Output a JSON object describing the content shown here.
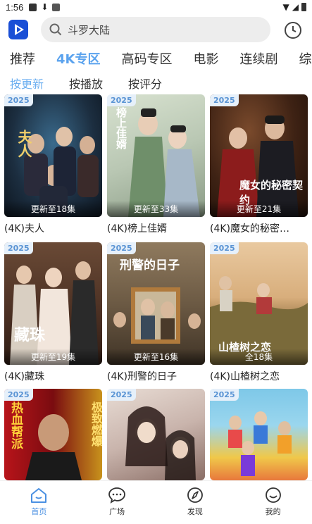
{
  "status_bar": {
    "time": "1:56"
  },
  "search": {
    "placeholder": "斗罗大陆"
  },
  "category_tabs": [
    {
      "label": "推荐"
    },
    {
      "label": "4K专区"
    },
    {
      "label": "高码专区"
    },
    {
      "label": "电影"
    },
    {
      "label": "连续剧"
    },
    {
      "label": "综"
    }
  ],
  "active_category": "4K专区",
  "sort_tabs": [
    {
      "label": "按更新"
    },
    {
      "label": "按播放"
    },
    {
      "label": "按评分"
    }
  ],
  "active_sort": "按更新",
  "cards": [
    {
      "year": "2025",
      "status": "更新至18集",
      "title": "(4K)夫人",
      "poster_text": "夫人"
    },
    {
      "year": "2025",
      "status": "更新至33集",
      "title": "(4K)榜上佳婿",
      "poster_text": "榜上佳婿"
    },
    {
      "year": "2025",
      "status": "更新至21集",
      "title": "(4K)魔女的秘密…",
      "poster_text": "魔女的秘密契约"
    },
    {
      "year": "2025",
      "status": "更新至19集",
      "title": "(4K)藏珠",
      "poster_text": "藏珠"
    },
    {
      "year": "2025",
      "status": "更新至16集",
      "title": "(4K)刑警的日子",
      "poster_text": "刑警的日子"
    },
    {
      "year": "2025",
      "status": "全18集",
      "title": "(4K)山楂树之恋",
      "poster_text": "山楂树之恋"
    },
    {
      "year": "2025",
      "status": "",
      "title": "",
      "poster_text": "热血帮派"
    },
    {
      "year": "2025",
      "status": "",
      "title": "",
      "poster_text": ""
    },
    {
      "year": "2025",
      "status": "",
      "title": "",
      "poster_text": ""
    }
  ],
  "poster_side_text": {
    "card7": "极致燃爆"
  },
  "bottom_nav": [
    {
      "label": "首页",
      "icon": "home-icon",
      "active": true
    },
    {
      "label": "广场",
      "icon": "chat-bubble-icon",
      "active": false
    },
    {
      "label": "发现",
      "icon": "compass-icon",
      "active": false
    },
    {
      "label": "我的",
      "icon": "smiley-icon",
      "active": false
    }
  ],
  "colors": {
    "accent": "#4a90e2",
    "search_bg": "#ededed",
    "year_badge_bg": "#e6f0fa"
  }
}
